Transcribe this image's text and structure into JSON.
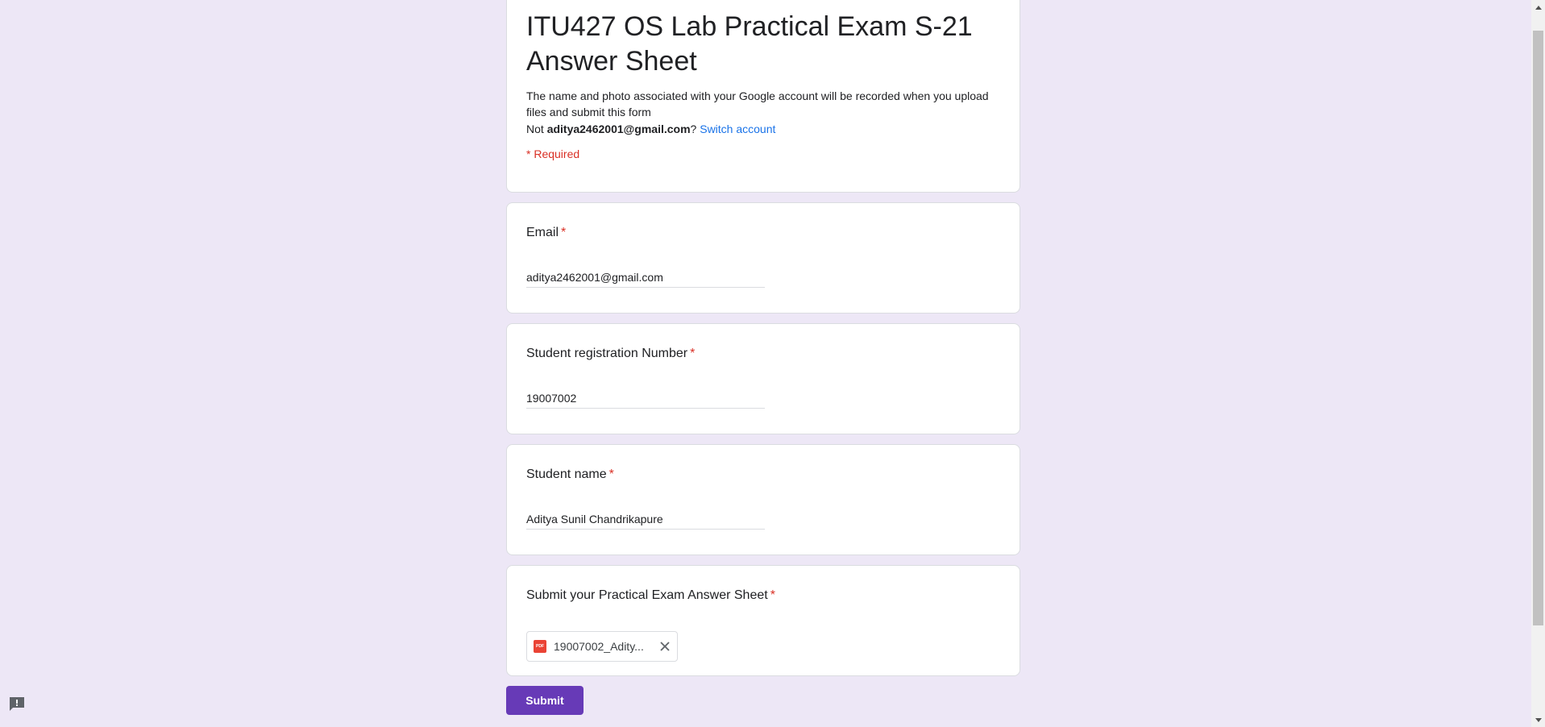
{
  "form": {
    "title": "ITU427 OS Lab Practical Exam S-21 Answer Sheet",
    "notice": "The name and photo associated with your Google account will be recorded when you upload files and submit this form",
    "account_prefix": "Not ",
    "account_email": "aditya2462001@gmail.com",
    "account_suffix": "? ",
    "switch_account": "Switch account",
    "required_note": "* Required"
  },
  "questions": [
    {
      "label": "Email",
      "required_star": "*",
      "value": "aditya2462001@gmail.com"
    },
    {
      "label": "Student registration Number",
      "required_star": "*",
      "value": "19007002"
    },
    {
      "label": "Student name",
      "required_star": "*",
      "value": "Aditya Sunil Chandrikapure"
    },
    {
      "label": "Submit your Practical Exam Answer Sheet",
      "required_star": "*",
      "file_name": "19007002_Adity..."
    }
  ],
  "file_icon_label": "PDF",
  "submit_label": "Submit",
  "colors": {
    "background": "#ede7f6",
    "accent": "#673ab7",
    "required": "#d93025",
    "link": "#1a73e8"
  },
  "icons": [
    "pdf-file-icon",
    "close-icon",
    "feedback-icon",
    "scroll-up-arrow-icon",
    "scroll-down-arrow-icon"
  ]
}
